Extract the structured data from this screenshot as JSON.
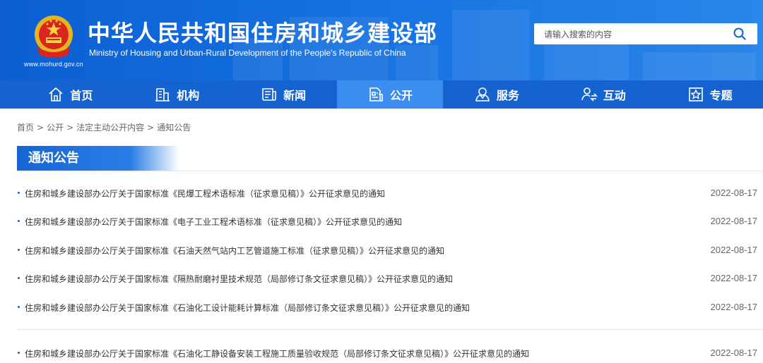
{
  "header": {
    "site_url": "www.mohurd.gov.cn",
    "title_cn": "中华人民共和国住房和城乡建设部",
    "title_en": "Ministry of Housing and Urban-Rural Development of the People's Republic of China",
    "search_placeholder": "请输入搜索的内容",
    "search_icon": "search-icon"
  },
  "nav": {
    "items": [
      {
        "label": "首页",
        "icon": "home-icon"
      },
      {
        "label": "机构",
        "icon": "building-icon"
      },
      {
        "label": "新闻",
        "icon": "news-icon"
      },
      {
        "label": "公开",
        "icon": "document-icon",
        "active": true
      },
      {
        "label": "服务",
        "icon": "service-icon"
      },
      {
        "label": "互动",
        "icon": "interaction-icon"
      },
      {
        "label": "专题",
        "icon": "star-icon"
      }
    ]
  },
  "breadcrumb": [
    "首页",
    "公开",
    "法定主动公开内容",
    "通知公告"
  ],
  "section_title": "通知公告",
  "colors": {
    "brand": "#1463d0",
    "active_nav": "#3b8df0"
  },
  "notices": [
    {
      "title": "住房和城乡建设部办公厅关于国家标准《民爆工程术语标准（征求意见稿）》公开征求意见的通知",
      "date": "2022-08-17"
    },
    {
      "title": "住房和城乡建设部办公厅关于国家标准《电子工业工程术语标准（征求意见稿）》公开征求意见的通知",
      "date": "2022-08-17"
    },
    {
      "title": "住房和城乡建设部办公厅关于国家标准《石油天然气站内工艺管道施工标准（征求意见稿）》公开征求意见的通知",
      "date": "2022-08-17"
    },
    {
      "title": "住房和城乡建设部办公厅关于国家标准《隔热耐磨衬里技术规范（局部修订条文征求意见稿）》公开征求意见的通知",
      "date": "2022-08-17"
    },
    {
      "title": "住房和城乡建设部办公厅关于国家标准《石油化工设计能耗计算标准（局部修订条文征求意见稿）》公开征求意见的通知",
      "date": "2022-08-17"
    },
    {
      "title": "住房和城乡建设部办公厅关于国家标准《石油化工静设备安装工程施工质量验收规范（局部修订条文征求意见稿）》公开征求意见的通知",
      "date": "2022-08-17"
    }
  ]
}
